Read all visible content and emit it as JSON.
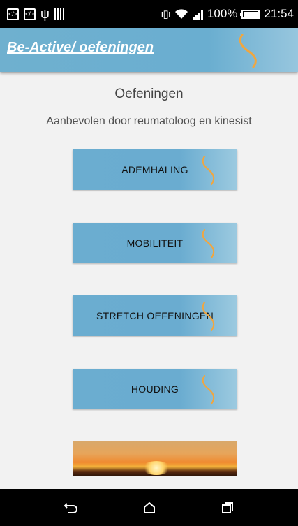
{
  "status_bar": {
    "battery_percent": "100%",
    "time": "21:54",
    "icons": [
      "code-icon",
      "code-icon",
      "usb-icon",
      "barcode-icon",
      "vibrate-icon",
      "wifi-icon",
      "signal-icon",
      "battery-icon"
    ]
  },
  "app_bar": {
    "title": "Be-Active/ oefeningen",
    "logo": "wave-logo-icon"
  },
  "main": {
    "title": "Oefeningen",
    "subtitle": "Aanbevolen door reumatoloog en kinesist",
    "buttons": [
      {
        "label": "ADEMHALING"
      },
      {
        "label": "MOBILITEIT"
      },
      {
        "label": "STRETCH OEFENINGEN"
      },
      {
        "label": "HOUDING"
      }
    ],
    "banner": "sunset-image"
  },
  "nav_bar": {
    "icons": [
      "back-icon",
      "home-icon",
      "recents-icon"
    ]
  },
  "colors": {
    "accent": "#6aaed0",
    "wave": "#f0a640",
    "background": "#f2f2f2"
  }
}
